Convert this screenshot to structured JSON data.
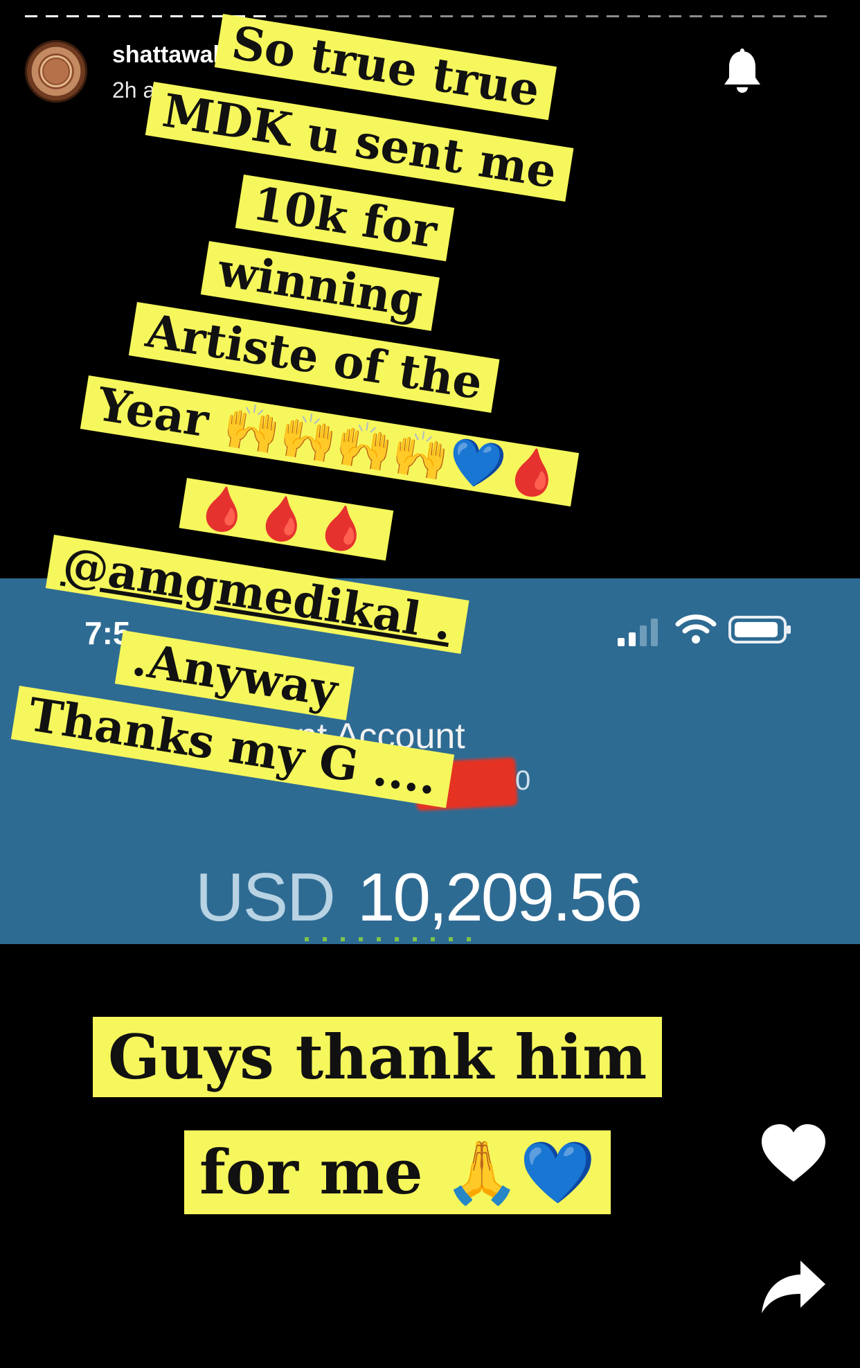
{
  "story": {
    "username": "shattawale",
    "time_ago": "2h ago",
    "progress": 0.3
  },
  "bank_screenshot": {
    "status_time": "7:5",
    "account_label": "ent Account",
    "account_tail": "0",
    "currency": "USD",
    "amount": "10,209.56",
    "background": "#2e6b93",
    "redaction_color": "#e53323"
  },
  "stickers": [
    "So true true",
    "MDK u sent me",
    "10k for",
    "winning",
    "Artiste of the",
    "Year",
    "@amgmedikal",
    ".Anyway",
    "Thanks my G ...."
  ],
  "sticker_emoji": {
    "hands": "🙌🙌🙌🙌",
    "blue_heart": "💙",
    "drop": "🩸",
    "drops_row": "🩸🩸🩸",
    "mention_suffix": " ."
  },
  "bottom_captions": {
    "line1": "Guys thank him",
    "line2": "for me",
    "line2_emoji_pray": "🙏",
    "line2_emoji_heart": "💙"
  },
  "colors": {
    "sticker_yellow": "#f6f75c",
    "background": "#000000"
  },
  "icons": {
    "notifications": "bell-icon",
    "like": "heart-icon",
    "share": "share-arrow-icon"
  }
}
